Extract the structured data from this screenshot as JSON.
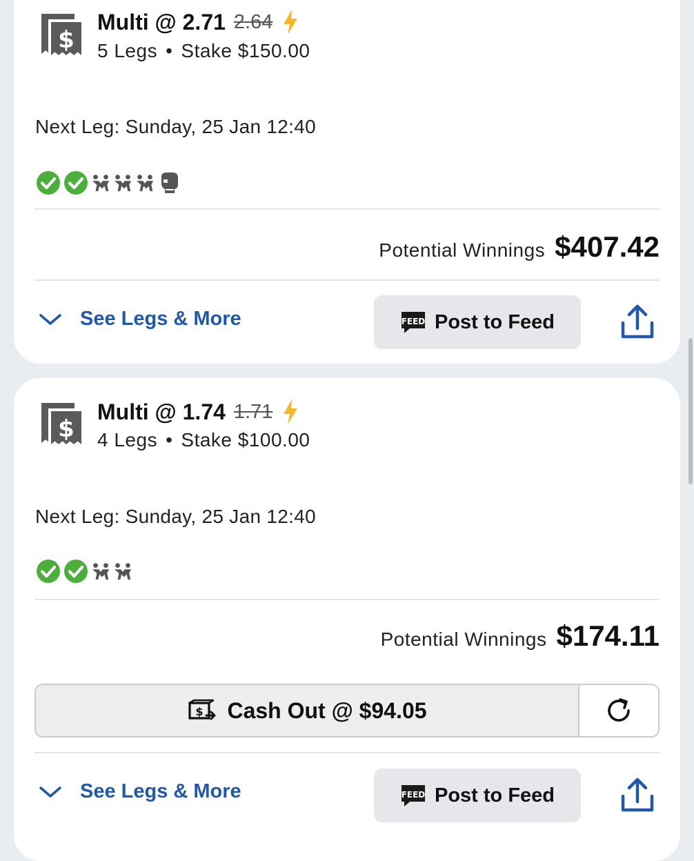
{
  "colors": {
    "accent_blue": "#2158a8",
    "success_green": "#4caf3c",
    "bolt_yellow": "#f4b62a",
    "icon_gray": "#555555"
  },
  "bets": [
    {
      "title": "Multi @ 2.71",
      "old_odds": "2.64",
      "legs": "5 Legs",
      "separator": "•",
      "stake": "Stake $150.00",
      "next_leg": "Next Leg: Sunday, 25 Jan 12:40",
      "leg_icons": [
        "check-icon",
        "check-icon",
        "runners-icon",
        "runners-icon",
        "runners-icon",
        "boxing-glove-icon"
      ],
      "winnings_label": "Potential Winnings",
      "winnings_amount": "$407.42",
      "see_legs_label": "See Legs & More",
      "post_feed_label": "Post to Feed"
    },
    {
      "title": "Multi @ 1.74",
      "old_odds": "1.71",
      "legs": "4 Legs",
      "separator": "•",
      "stake": "Stake $100.00",
      "next_leg": "Next Leg: Sunday, 25 Jan 12:40",
      "leg_icons": [
        "check-icon",
        "check-icon",
        "runners-icon",
        "runners-icon"
      ],
      "winnings_label": "Potential Winnings",
      "winnings_amount": "$174.11",
      "cashout_label": "Cash Out @ $94.05",
      "see_legs_label": "See Legs & More",
      "post_feed_label": "Post to Feed"
    }
  ]
}
